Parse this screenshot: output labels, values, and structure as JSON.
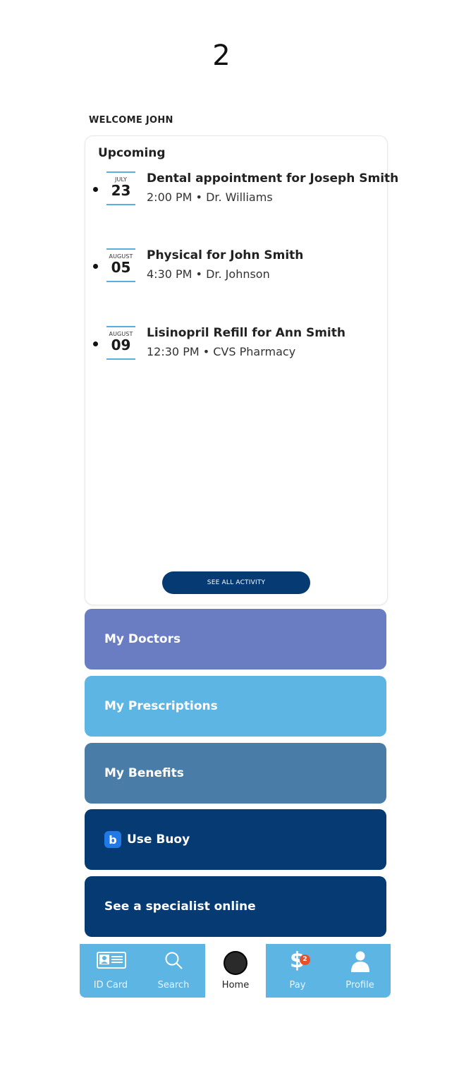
{
  "step_number": "2",
  "welcome_text": "WELCOME JOHN",
  "upcoming": {
    "title": "Upcoming",
    "appointments": [
      {
        "month": "JULY",
        "day": "23",
        "title": "Dental appointment for Joseph Smith",
        "detail": "2:00 PM • Dr. Williams"
      },
      {
        "month": "AUGUST",
        "day": "05",
        "title": "Physical for John Smith",
        "detail": "4:30 PM • Dr. Johnson"
      },
      {
        "month": "AUGUST",
        "day": "09",
        "title": "Lisinopril Refill for Ann Smith",
        "detail": "12:30 PM • CVS Pharmacy"
      }
    ],
    "see_all_label": "SEE ALL ACTIVITY"
  },
  "tiles": {
    "doctors": "My Doctors",
    "prescriptions": "My Prescriptions",
    "benefits": "My Benefits",
    "buoy": "Use Buoy",
    "buoy_icon_letter": "b",
    "specialist": "See a specialist online"
  },
  "colors": {
    "doctors": "#6b7dc2",
    "prescriptions": "#5db5e4",
    "benefits": "#4a7ca8",
    "buoy": "#063a73",
    "specialist": "#063a73",
    "tabbar": "#5db5e4",
    "primary_button": "#063a73",
    "badge": "#e8502d"
  },
  "tabbar": {
    "id_card": {
      "label": "ID Card",
      "icon": "id-card-icon"
    },
    "search": {
      "label": "Search",
      "icon": "search-icon"
    },
    "home": {
      "label": "Home",
      "icon": "home-circle-icon"
    },
    "pay": {
      "label": "Pay",
      "icon": "dollar-icon",
      "badge": "2"
    },
    "profile": {
      "label": "Profile",
      "icon": "person-icon"
    }
  }
}
